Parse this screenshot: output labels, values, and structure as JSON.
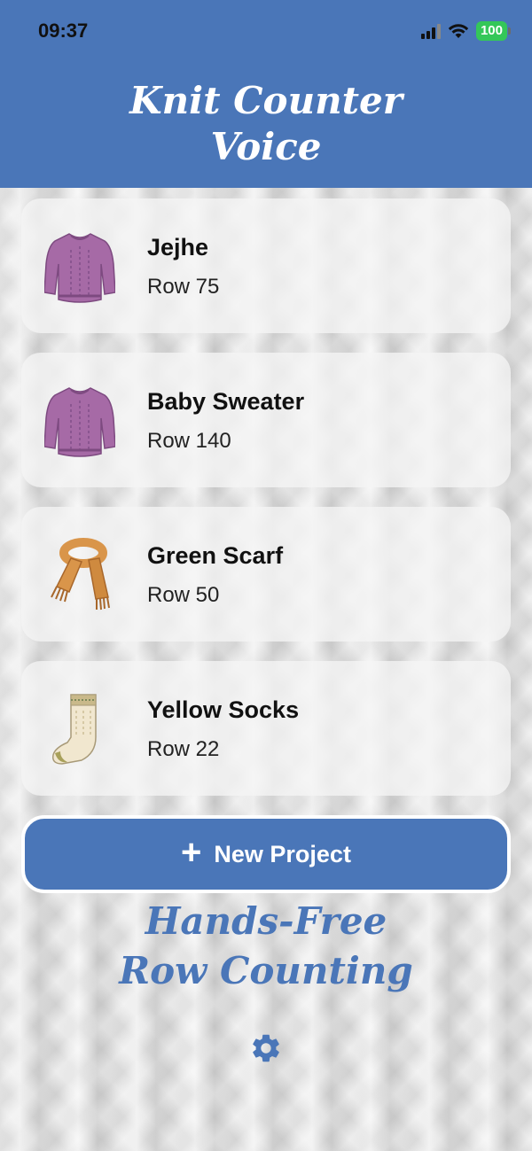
{
  "status_bar": {
    "time": "09:37",
    "battery": "100"
  },
  "header": {
    "title_line1": "Knit Counter",
    "title_line2": "Voice"
  },
  "projects": [
    {
      "name": "Jejhe",
      "row": "Row 75",
      "icon": "sweater-icon"
    },
    {
      "name": "Baby Sweater",
      "row": "Row 140",
      "icon": "sweater-icon"
    },
    {
      "name": "Green Scarf",
      "row": "Row 50",
      "icon": "scarf-icon"
    },
    {
      "name": "Yellow Socks",
      "row": "Row 22",
      "icon": "sock-icon"
    }
  ],
  "new_project": {
    "plus": "+",
    "label": "New Project"
  },
  "tagline": {
    "line1": "Hands-Free",
    "line2": "Row Counting"
  },
  "colors": {
    "accent": "#4a76b8",
    "sweater": "#a66aa6",
    "scarf": "#d9954a",
    "sock": "#f1e7cf",
    "battery": "#34c759"
  },
  "settings_icon": "gear-icon"
}
